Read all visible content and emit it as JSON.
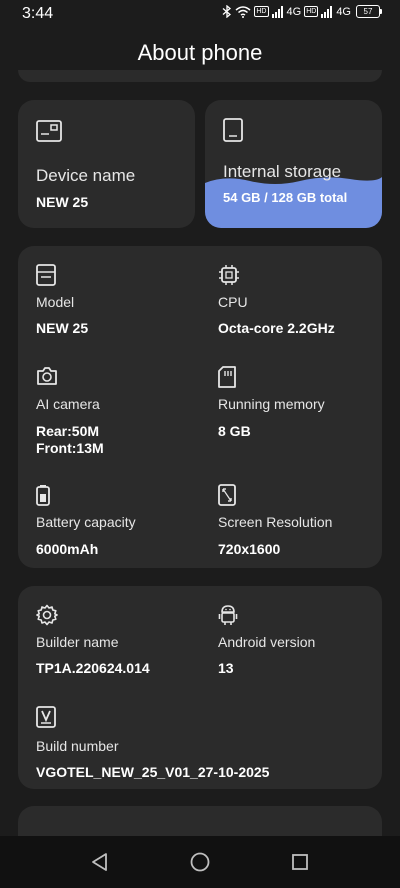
{
  "status_bar": {
    "time": "3:44",
    "network_1": "4G",
    "network_2": "4G",
    "hd_label": "HD",
    "battery": "57"
  },
  "header": {
    "title": "About phone"
  },
  "device_card": {
    "label": "Device name",
    "value": "NEW 25",
    "icon": "device-icon"
  },
  "storage_card": {
    "label": "Internal storage",
    "value": "54 GB / 128 GB total",
    "used_fraction": 0.42,
    "fill_color": "#6f8ee0"
  },
  "specs": [
    {
      "key": "model",
      "label": "Model",
      "value": "NEW 25",
      "icon": "model-icon"
    },
    {
      "key": "cpu",
      "label": "CPU",
      "value": "Octa-core 2.2GHz",
      "icon": "cpu-icon"
    },
    {
      "key": "camera",
      "label": "AI camera",
      "value_line1": "Rear:50M",
      "value_line2": "Front:13M",
      "icon": "camera-icon"
    },
    {
      "key": "memory",
      "label": "Running memory",
      "value": "8 GB",
      "icon": "memory-icon"
    },
    {
      "key": "battery",
      "label": "Battery capacity",
      "value": "6000mAh",
      "icon": "battery-icon"
    },
    {
      "key": "resolution",
      "label": "Screen Resolution",
      "value": "720x1600",
      "icon": "screen-icon"
    }
  ],
  "build": [
    {
      "key": "builder",
      "label": "Builder name",
      "value": "TP1A.220624.014",
      "icon": "gear-icon"
    },
    {
      "key": "android",
      "label": "Android version",
      "value": "13",
      "icon": "android-icon"
    },
    {
      "key": "build_number",
      "label": "Build number",
      "value": "VGOTEL_NEW_25_V01_27-10-2025",
      "icon": "version-icon"
    }
  ],
  "nav": {
    "back": "back-icon",
    "home": "home-icon",
    "recents": "recents-icon"
  },
  "colors": {
    "background": "#1c1c1c",
    "card": "#2b2b2b",
    "accent": "#6f8ee0"
  }
}
